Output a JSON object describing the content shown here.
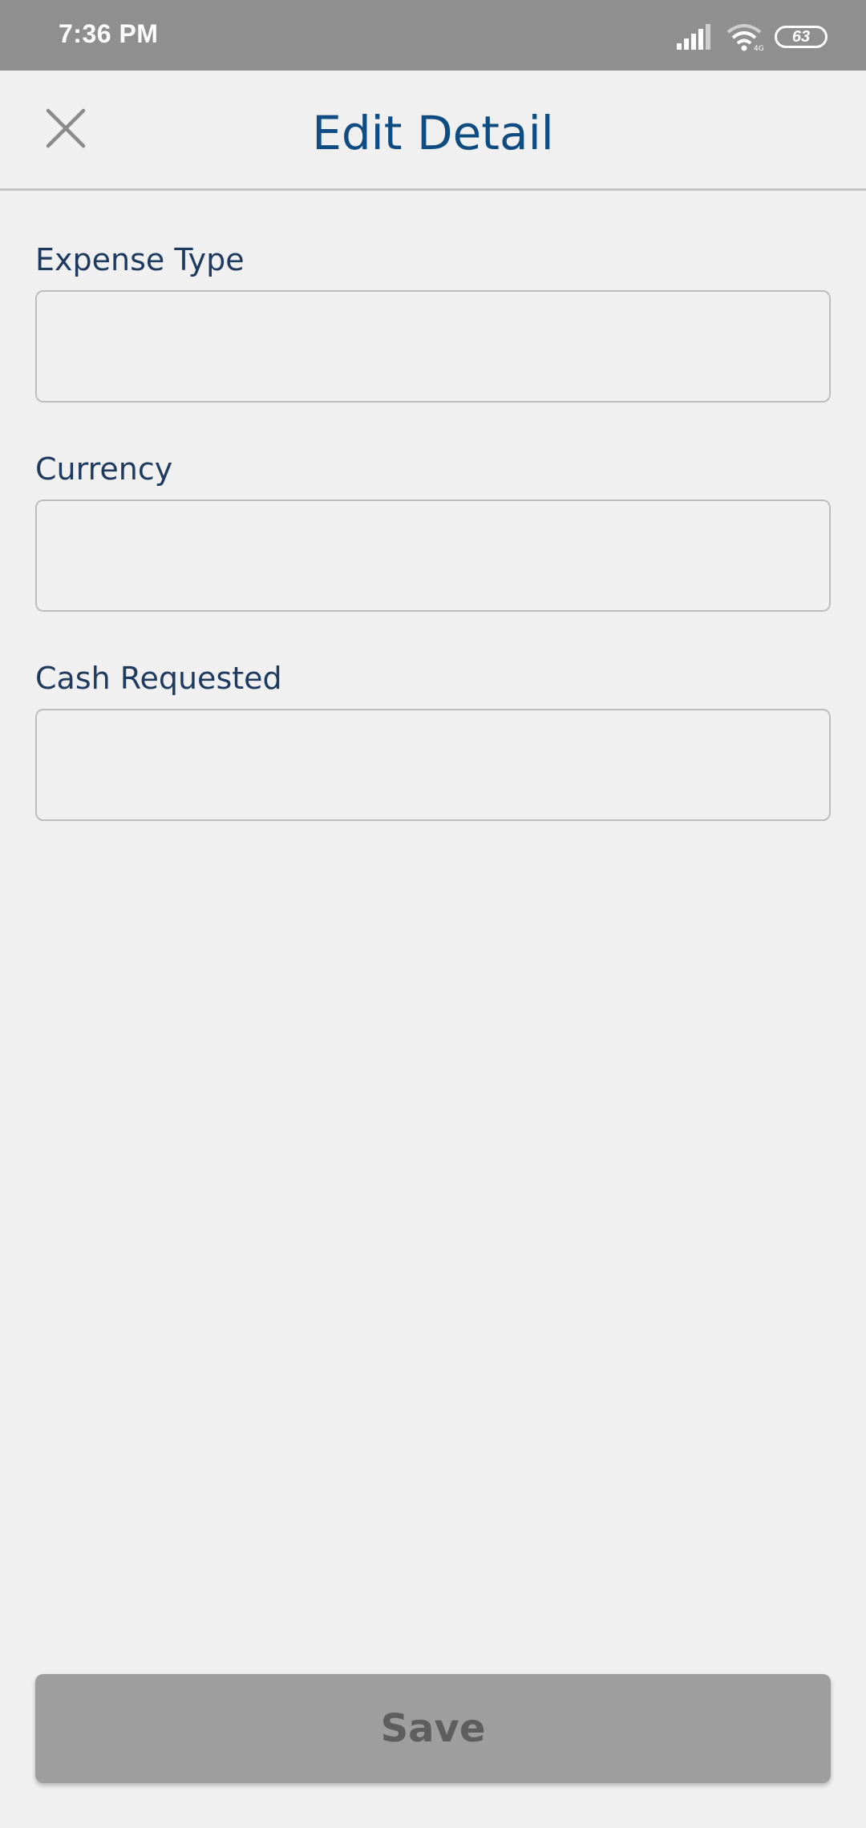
{
  "status_bar": {
    "time": "7:36 PM",
    "battery": "63",
    "icons": [
      "signal-icon",
      "wifi-icon",
      "battery-icon"
    ]
  },
  "header": {
    "title": "Edit Detail",
    "close_icon": "close-icon"
  },
  "form": {
    "fields": [
      {
        "label": "Expense Type",
        "value": ""
      },
      {
        "label": "Currency",
        "value": ""
      },
      {
        "label": "Cash Requested",
        "value": ""
      }
    ]
  },
  "actions": {
    "save_label": "Save"
  },
  "colors": {
    "status_bar": "#8f8f8f",
    "title": "#0f4c81",
    "label": "#1e3a5f",
    "button_bg": "#9e9e9e",
    "button_text": "#5e5e5e",
    "background": "#f0f0f0"
  }
}
